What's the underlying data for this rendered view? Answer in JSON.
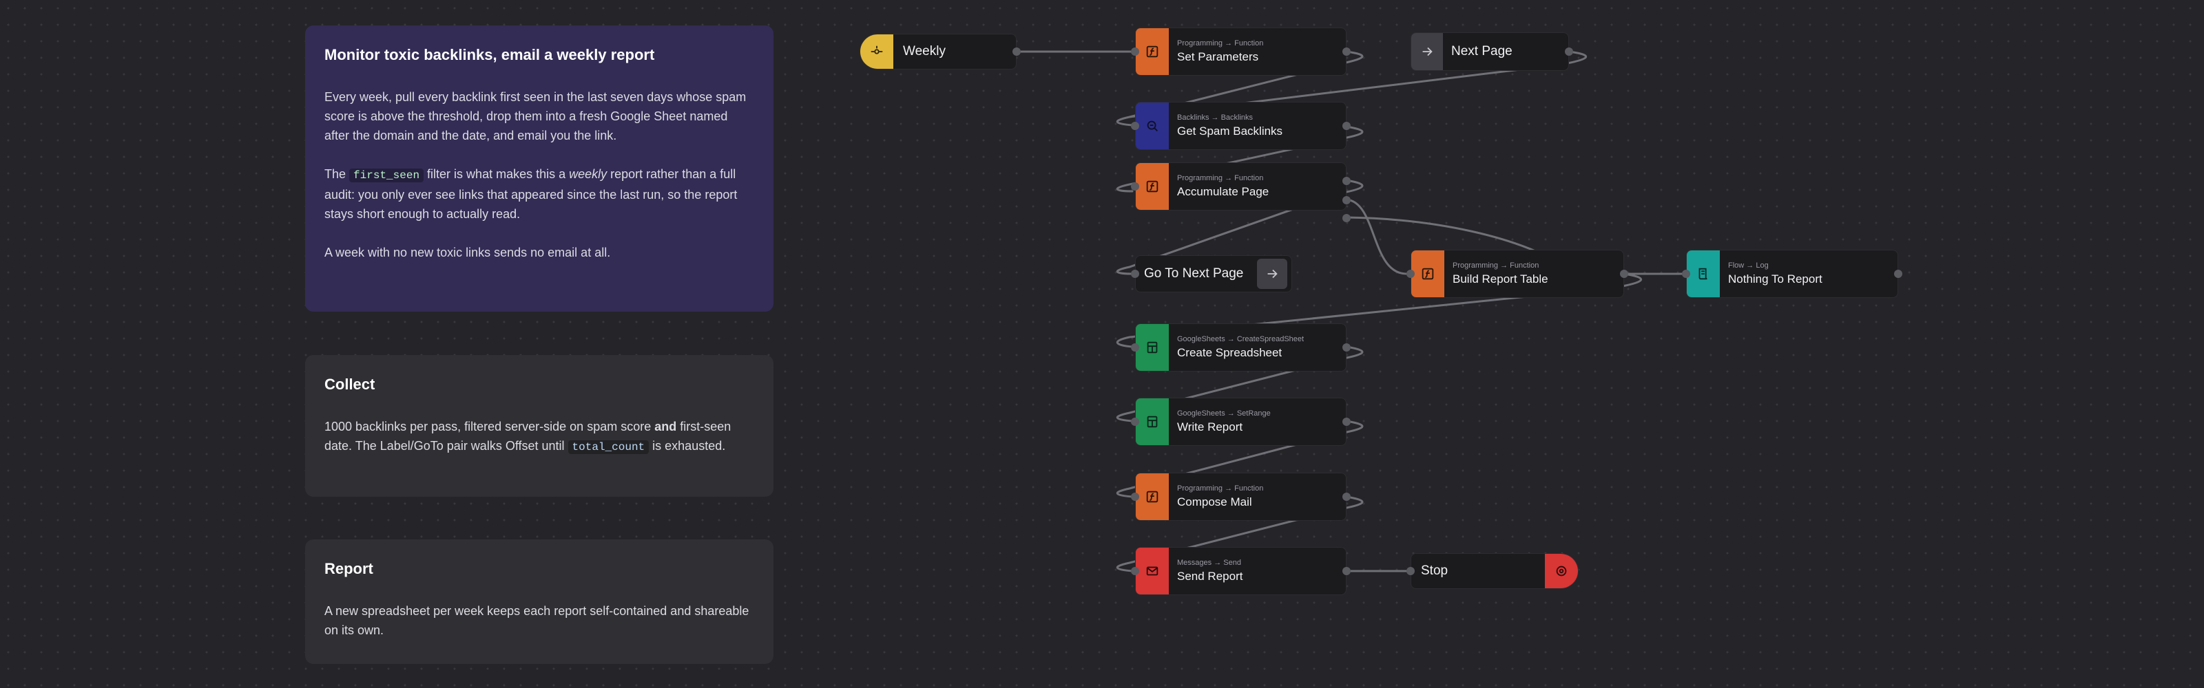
{
  "notes": {
    "intro": {
      "title": "Monitor toxic backlinks, email a weekly report",
      "p1": "Every week, pull every backlink first seen in the last seven days whose spam score is above the threshold, drop them into a fresh Google Sheet named after the domain and the date, and email you the link.",
      "p2_pre": "The ",
      "p2_code": "first_seen",
      "p2_mid": " filter is what makes this a ",
      "p2_em": "weekly",
      "p2_post": " report rather than a full audit: you only ever see links that appeared since the last run, so the report stays short enough to actually read.",
      "p3": "A week with no new toxic links sends no email at all."
    },
    "collect": {
      "title": "Collect",
      "p_pre": "1000 backlinks per pass, filtered server-side on spam score ",
      "p_bold": "and",
      "p_mid": " first-seen date. The Label/GoTo pair walks Offset until ",
      "p_code": "total_count",
      "p_post": " is exhausted."
    },
    "report": {
      "title": "Report",
      "p": "A new spreadsheet per week keeps each report self-contained and shareable on its own."
    }
  },
  "nodes": {
    "weekly": {
      "title": "Weekly",
      "icon": "trigger-icon",
      "color": "#e2b93b"
    },
    "set_parameters": {
      "sub": "Programming → Function",
      "title": "Set Parameters",
      "icon": "function-icon",
      "color": "#d9652a"
    },
    "next_page": {
      "title": "Next Page",
      "icon": "arrow-right-icon",
      "color": "#3f3f45"
    },
    "get_spam_backlinks": {
      "sub": "Backlinks → Backlinks",
      "title": "Get Spam Backlinks",
      "icon": "search-link-icon",
      "color": "#2c2f8c"
    },
    "accumulate_page": {
      "sub": "Programming → Function",
      "title": "Accumulate Page",
      "icon": "function-icon",
      "color": "#d9652a"
    },
    "go_to_next_page": {
      "title": "Go To Next Page",
      "icon": "arrow-right-icon",
      "color": "#3f3f45"
    },
    "build_report_table": {
      "sub": "Programming → Function",
      "title": "Build Report Table",
      "icon": "function-icon",
      "color": "#d9652a"
    },
    "nothing_to_report": {
      "sub": "Flow → Log",
      "title": "Nothing To Report",
      "icon": "log-scroll-icon",
      "color": "#17a39a"
    },
    "create_spreadsheet": {
      "sub": "GoogleSheets → CreateSpreadSheet",
      "title": "Create Spreadsheet",
      "icon": "sheet-icon",
      "color": "#1f9152"
    },
    "write_report": {
      "sub": "GoogleSheets → SetRange",
      "title": "Write Report",
      "icon": "sheet-icon",
      "color": "#1f9152"
    },
    "compose_mail": {
      "sub": "Programming → Function",
      "title": "Compose Mail",
      "icon": "function-icon",
      "color": "#d9652a"
    },
    "send_report": {
      "sub": "Messages → Send",
      "title": "Send Report",
      "icon": "mail-icon",
      "color": "#d93636"
    },
    "stop": {
      "title": "Stop",
      "icon": "stop-icon",
      "color": "#d93636"
    }
  }
}
